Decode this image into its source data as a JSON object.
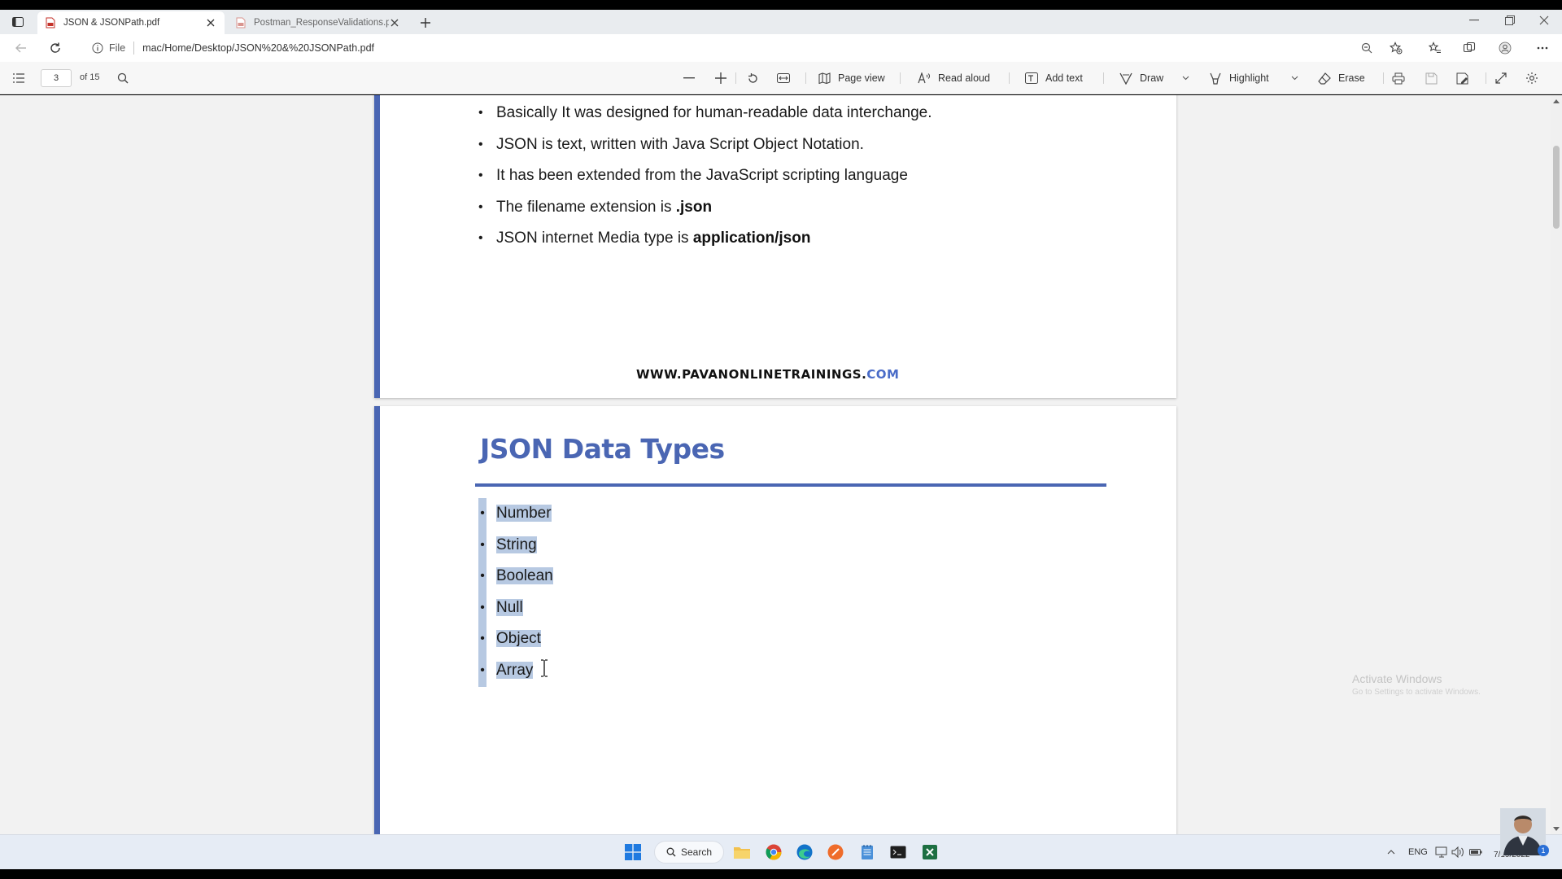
{
  "browser": {
    "tabs": [
      {
        "title": "JSON & JSONPath.pdf",
        "active": true
      },
      {
        "title": "Postman_ResponseValidations.p",
        "active": false
      }
    ],
    "address": {
      "scheme_label": "File",
      "url": "mac/Home/Desktop/JSON%20&%20JSONPath.pdf"
    }
  },
  "pdf_toolbar": {
    "current_page": "3",
    "total_pages": "of 15",
    "page_view_label": "Page view",
    "read_aloud_label": "Read aloud",
    "add_text_label": "Add text",
    "draw_label": "Draw",
    "highlight_label": "Highlight",
    "erase_label": "Erase"
  },
  "document": {
    "page1": {
      "bullets": [
        {
          "text": "Basically It was designed for human-readable data interchange.",
          "bold": ""
        },
        {
          "text": "JSON is text, written with Java Script Object Notation.",
          "bold": ""
        },
        {
          "text": "It has been extended from the JavaScript scripting language",
          "bold": ""
        },
        {
          "text": "The filename extension is ",
          "bold": ".json"
        },
        {
          "text": "JSON internet Media type is ",
          "bold": "application/json"
        }
      ],
      "footer_main": "WWW.PAVANONLINETRAININGS.",
      "footer_tld": "COM"
    },
    "page2": {
      "title": "JSON Data Types",
      "types": [
        "Number",
        "String",
        "Boolean",
        "Null",
        "Object",
        "Array"
      ]
    }
  },
  "overlay": {
    "watermark_title": "Activate Windows",
    "watermark_subtitle": "Go to Settings to activate Windows."
  },
  "taskbar": {
    "search_label": "Search",
    "language": "ENG",
    "date": "7/19/2022",
    "notification_count": "1"
  },
  "colors": {
    "accent_blue": "#4a66b3",
    "selection": "#b7c9e2",
    "viewer_bg": "#f2f2f2"
  }
}
